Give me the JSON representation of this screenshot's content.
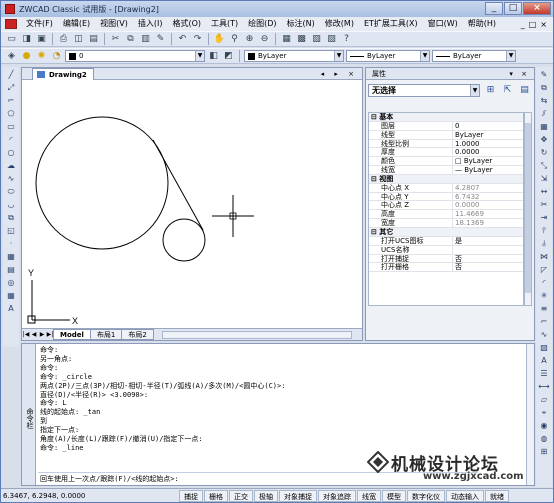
{
  "window": {
    "title": "ZWCAD Classic 试用版 - [Drawing2]",
    "controls": [
      "_",
      "□",
      "×"
    ]
  },
  "menu": {
    "items": [
      "文件(F)",
      "编辑(E)",
      "视图(V)",
      "插入(I)",
      "格式(O)",
      "工具(T)",
      "绘图(D)",
      "标注(N)",
      "修改(M)",
      "ET扩展工具(X)",
      "窗口(W)",
      "帮助(H)"
    ],
    "tail": [
      "_",
      "□",
      "×"
    ]
  },
  "toolbar2": {
    "layer_value": "0",
    "color_value": "ByLayer",
    "linetype_value": "ByLayer",
    "lineweight_value": "ByLayer"
  },
  "document": {
    "tab": "Drawing2",
    "controls": "◂ ▸ ×",
    "axis_x": "X",
    "axis_y": "Y",
    "layout_tabs": [
      "Model",
      "布局1",
      "布局2"
    ]
  },
  "properties": {
    "title": "属性",
    "controls": "▾ ×",
    "selection": "无选择",
    "rows": [
      {
        "type": "section",
        "k": "⊟ 基本"
      },
      {
        "k": "图层",
        "v": "0"
      },
      {
        "k": "线型",
        "v": "ByLayer"
      },
      {
        "k": "线型比例",
        "v": "1.0000"
      },
      {
        "k": "厚度",
        "v": "0.0000"
      },
      {
        "k": "颜色",
        "v": "□ ByLayer"
      },
      {
        "k": "线宽",
        "v": "— ByLayer"
      },
      {
        "type": "section",
        "k": "⊟ 视图"
      },
      {
        "k": "中心点 X",
        "v": "4.2807",
        "gray": true
      },
      {
        "k": "中心点 Y",
        "v": "6.7432",
        "gray": true
      },
      {
        "k": "中心点 Z",
        "v": "0.0000",
        "gray": true
      },
      {
        "k": "高度",
        "v": "11.4669",
        "gray": true
      },
      {
        "k": "宽度",
        "v": "18.1369",
        "gray": true
      },
      {
        "type": "section",
        "k": "⊟ 其它"
      },
      {
        "k": "打开UCS图标",
        "v": "是"
      },
      {
        "k": "UCS名称",
        "v": ""
      },
      {
        "k": "打开捕捉",
        "v": "否"
      },
      {
        "k": "打开栅格",
        "v": "否"
      }
    ]
  },
  "command": {
    "side_label": "命令栏",
    "lines": [
      "命令:",
      "另一角点:",
      "命令:",
      "命令: _circle",
      "两点(2P)/三点(3P)/相切-相切-半径(T)/弧线(A)/多次(M)/<圆中心(C)>:",
      "直径(D)/<半径(R)> <3.0090>:",
      "命令: L",
      "线的起始点: _tan",
      "到",
      "指定下一点:",
      "角度(A)/长度(L)/跟踪(F)/撤消(U)/指定下一点:",
      "命令: _line",
      "回车使用上一次点/跟踪(F)/<线的起始点>:"
    ],
    "prompt": "回车使用上一次点/跟踪(F)/<线的起始点>:"
  },
  "status": {
    "coords": "6.3467, 6.2948, 0.0000",
    "buttons": [
      "捕捉",
      "栅格",
      "正交",
      "极轴",
      "对象捕捉",
      "对象追踪",
      "线宽",
      "模型",
      "数字化仪",
      "动态输入",
      "就绪"
    ]
  },
  "watermark": {
    "title": "机械设计论坛",
    "url": "www.zgjxcad.com"
  },
  "colors": {
    "title_gradient_top": "#c9d7ee",
    "canvas_bg": "#ffffff",
    "panel_bg": "#dfe6f1",
    "app_icon": "#cc2020"
  }
}
